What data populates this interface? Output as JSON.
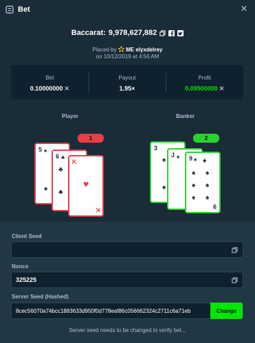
{
  "header": {
    "title": "Bet",
    "close_icon": "close-icon"
  },
  "summary": {
    "game": "Baccarat:",
    "bet_id": "9,978,627,882",
    "placed_prefix": "Placed by",
    "rank": "ME",
    "username": "elyxdelrey",
    "date": "on 10/12/2019 at 4:56 AM"
  },
  "stats": {
    "bet_label": "Bet",
    "bet_value": "0.10000000",
    "payout_label": "Payout",
    "payout_value": "1.95×",
    "profit_label": "Profit",
    "profit_value": "0.09500000"
  },
  "player": {
    "label": "Player",
    "score": "1",
    "cards": [
      {
        "rank": "5",
        "suit": "♠",
        "color": "black"
      },
      {
        "rank": "6",
        "suit": "♣",
        "color": "black"
      },
      {
        "rank": "K",
        "suit": "♥",
        "color": "red"
      }
    ]
  },
  "banker": {
    "label": "Banker",
    "score": "2",
    "cards": [
      {
        "rank": "3",
        "suit": "♠",
        "color": "black"
      },
      {
        "rank": "J",
        "suit": "♠",
        "color": "black"
      },
      {
        "rank": "9",
        "suit": "♠",
        "color": "black"
      }
    ]
  },
  "fairness": {
    "client_seed_label": "Client Seed",
    "client_seed_value": "",
    "nonce_label": "Nonce",
    "nonce_value": "325225",
    "server_seed_label": "Server Seed (Hashed)",
    "server_seed_value": "8cec56070a74bcc1883633d950f0d778eaf86c056662324c2711c6a71eb",
    "change_label": "Change",
    "footnote": "Server seed needs to be changed to verify bet..."
  },
  "colors": {
    "background": "#1a2c38",
    "panel": "#0f212e",
    "accent_green": "#00e701",
    "player_red": "#e63f4a",
    "banker_green": "#2bd32e"
  }
}
